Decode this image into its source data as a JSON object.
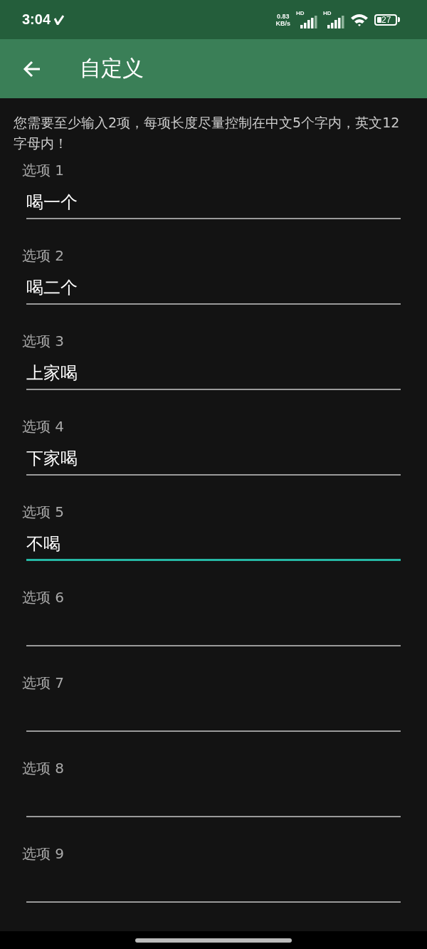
{
  "status_bar": {
    "time": "3:04",
    "net_speed": "0.83",
    "net_unit": "KB/s",
    "signals": [
      {
        "label": "HD"
      },
      {
        "label": "HD"
      }
    ],
    "battery": "27"
  },
  "app_bar": {
    "title": "自定义"
  },
  "instructions": "您需要至少输入2项，每项长度尽量控制在中文5个字内，英文12字母内！",
  "options": [
    {
      "label": "选项 1",
      "value": "喝一个",
      "focused": false
    },
    {
      "label": "选项 2",
      "value": "喝二个",
      "focused": false
    },
    {
      "label": "选项 3",
      "value": "上家喝",
      "focused": false
    },
    {
      "label": "选项 4",
      "value": "下家喝",
      "focused": false
    },
    {
      "label": "选项 5",
      "value": "不喝",
      "focused": true
    },
    {
      "label": "选项 6",
      "focused": false
    },
    {
      "label": "选项 7",
      "focused": false
    },
    {
      "label": "选项 8",
      "focused": false
    },
    {
      "label": "选项 9",
      "focused": false
    }
  ]
}
